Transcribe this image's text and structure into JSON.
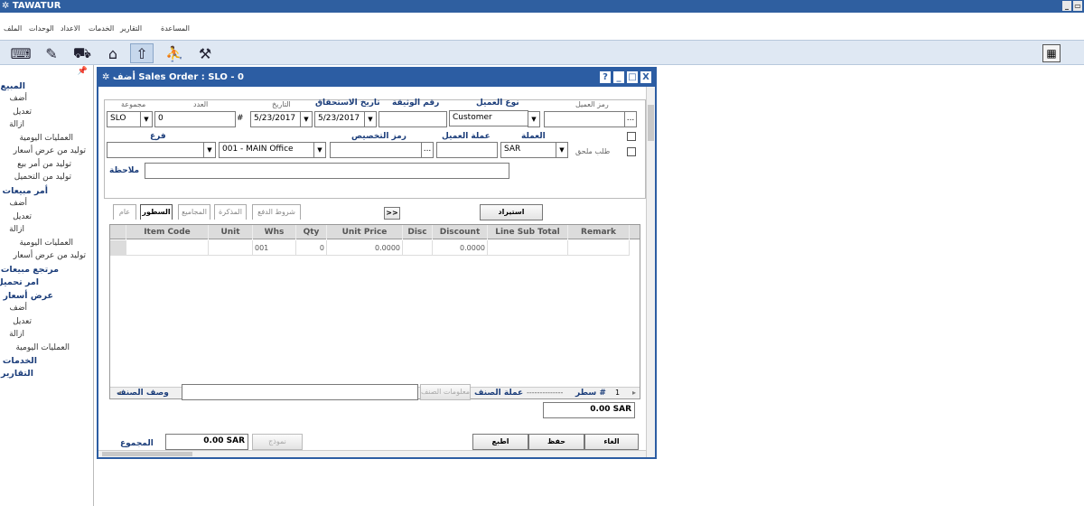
{
  "app": {
    "title": "TAWATUR"
  },
  "menu": {
    "items": [
      "المساعدة",
      "التقارير",
      "الخدمات",
      "الاعداد",
      "الوحدات",
      "الملف"
    ]
  },
  "sidebar": {
    "groups": [
      {
        "title": "المبيع",
        "items": [
          "أضف",
          "تعديل",
          "ازالة",
          "العمليات اليومية",
          "توليد من عرض أسعار",
          "توليد من أمر بيع",
          "توليد من التحميل"
        ]
      },
      {
        "title": "أمر مبيعات",
        "items": [
          "أضف",
          "تعديل",
          "ازالة",
          "العمليات اليومية",
          "توليد من عرض أسعار"
        ]
      },
      {
        "title": "مرتجع مبيعات",
        "items": []
      },
      {
        "title": "امر تحميل",
        "items": []
      },
      {
        "title": "عرض أسعار",
        "items": [
          "أضف",
          "تعديل",
          "ازالة",
          "العمليات اليومية"
        ]
      },
      {
        "title": "الخدمات",
        "items": []
      },
      {
        "title": "التقارير",
        "items": []
      }
    ]
  },
  "dialog": {
    "title": "أضف Sales Order : SLO - 0",
    "buttons": [
      "?",
      "_",
      "□",
      "X"
    ]
  },
  "form": {
    "series_label": "مجموعة",
    "series_value": "SLO",
    "number_label": "العدد",
    "number_value": "0",
    "hash": "#",
    "date_label": "التاريخ",
    "date_value": "5/23/2017",
    "due_date_label": "تاريخ الاستحقاق",
    "due_date_value": "5/23/2017",
    "doc_no_label": "رقم الوثيقة",
    "doc_no_value": "",
    "customer_type_label": "نوع العميل",
    "customer_type_value": "Customer",
    "customer_code_label": "رمز العميل",
    "customer_code_value": "",
    "browse": "...",
    "branch_label": "فرع",
    "branch_value": "",
    "office_value": "001  - MAIN Office",
    "cost_center_label": "رمز التخصيص",
    "cost_center_value": "",
    "customer_currency_label": "عملة العميل",
    "customer_currency_value": "",
    "currency_label": "العملة",
    "currency_value": "SAR",
    "attach_label": "طلب ملحق",
    "notes_label": "ملاحظة",
    "notes_value": ""
  },
  "tabs": [
    "عام",
    "السطور",
    "المجاميع",
    "المذكرة",
    "شروط الدفع"
  ],
  "nav_button": ">>",
  "import_button": "استيراد",
  "grid": {
    "columns": [
      "Item Code",
      "Unit",
      "Whs",
      "Qty",
      "Unit Price",
      "Disc",
      "Discount",
      "Line Sub Total",
      "Remark"
    ],
    "rows": [
      {
        "item_code": "",
        "unit": "",
        "whs": "001",
        "qty": "0",
        "unit_price": "0.0000",
        "disc": "",
        "discount": "0.0000",
        "line_sub_total": "",
        "remark": ""
      }
    ]
  },
  "footer": {
    "item_desc_label": "وصف الصنف",
    "item_desc_value": "",
    "item_info_button": "معلومات الصنف",
    "item_currency_label": "عملة الصنف",
    "item_currency_value": "--------------",
    "row_label": "# سطر",
    "row_value": "1",
    "line_total": "0.00 SAR",
    "total_label": "المجموع",
    "total_value": "0.00 SAR",
    "model_button": "نموذج",
    "print_button": "اطبع",
    "save_button": "حفظ",
    "cancel_button": "الغاء"
  }
}
